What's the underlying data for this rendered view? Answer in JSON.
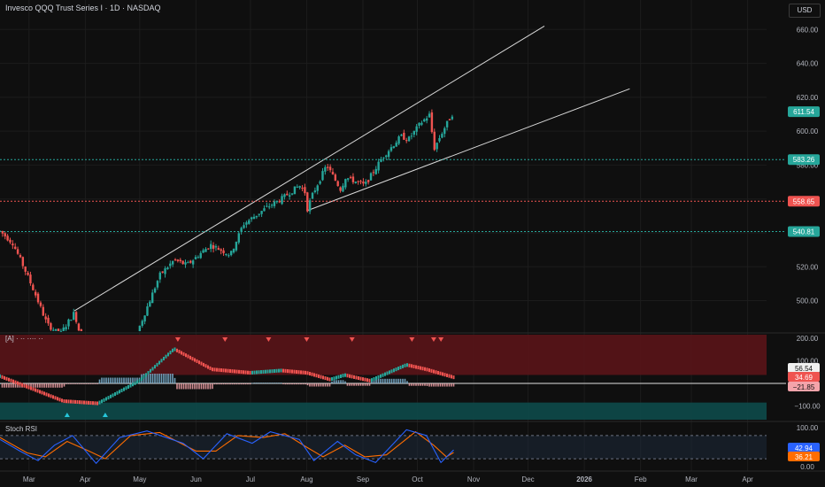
{
  "header": {
    "title": "Invesco QQQ Trust Series I · 1D · NASDAQ",
    "currency": "USD"
  },
  "colors": {
    "up": "#26a69a",
    "down": "#ef5350",
    "grid": "#1c1c1c",
    "text": "#b2b5be",
    "trendline": "#d9d9d9"
  },
  "chart_data": [
    {
      "type": "candlestick",
      "title": "Invesco QQQ Trust Series I · 1D · NASDAQ",
      "x_ticks": [
        "Mar",
        "Apr",
        "May",
        "Jun",
        "Jul",
        "Aug",
        "Sep",
        "Oct",
        "Nov",
        "Dec",
        "2026",
        "Feb",
        "Mar",
        "Apr"
      ],
      "y_ticks": [
        500,
        520,
        540,
        560,
        580,
        600,
        620,
        640,
        660
      ],
      "ylim": [
        482,
        668
      ],
      "last_price": 611.54,
      "price_path": [
        {
          "date": "2025-02-13",
          "close": 541
        },
        {
          "date": "2025-02-20",
          "close": 534
        },
        {
          "date": "2025-02-26",
          "close": 520
        },
        {
          "date": "2025-03-04",
          "close": 505
        },
        {
          "date": "2025-03-11",
          "close": 486
        },
        {
          "date": "2025-03-18",
          "close": 480
        },
        {
          "date": "2025-03-26",
          "close": 493
        },
        {
          "date": "2025-04-04",
          "close": 455
        },
        {
          "date": "2025-04-08",
          "close": 425
        },
        {
          "date": "2025-04-10",
          "close": 455
        },
        {
          "date": "2025-04-21",
          "close": 445
        },
        {
          "date": "2025-05-01",
          "close": 485
        },
        {
          "date": "2025-05-12",
          "close": 515
        },
        {
          "date": "2025-05-20",
          "close": 524
        },
        {
          "date": "2025-05-27",
          "close": 521
        },
        {
          "date": "2025-06-09",
          "close": 533
        },
        {
          "date": "2025-06-20",
          "close": 527
        },
        {
          "date": "2025-06-27",
          "close": 545
        },
        {
          "date": "2025-07-10",
          "close": 555
        },
        {
          "date": "2025-07-18",
          "close": 560
        },
        {
          "date": "2025-07-28",
          "close": 568
        },
        {
          "date": "2025-07-31",
          "close": 564
        },
        {
          "date": "2025-08-01",
          "close": 553
        },
        {
          "date": "2025-08-04",
          "close": 562
        },
        {
          "date": "2025-08-12",
          "close": 580
        },
        {
          "date": "2025-08-20",
          "close": 565
        },
        {
          "date": "2025-08-22",
          "close": 573
        },
        {
          "date": "2025-09-02",
          "close": 568
        },
        {
          "date": "2025-09-12",
          "close": 585
        },
        {
          "date": "2025-09-22",
          "close": 597
        },
        {
          "date": "2025-09-26",
          "close": 595
        },
        {
          "date": "2025-10-03",
          "close": 605
        },
        {
          "date": "2025-10-08",
          "close": 610
        },
        {
          "date": "2025-10-10",
          "close": 589
        },
        {
          "date": "2025-10-14",
          "close": 598
        },
        {
          "date": "2025-10-17",
          "close": 604
        },
        {
          "date": "2025-10-21",
          "close": 611.54
        }
      ],
      "horizontal_levels": [
        {
          "value": 583.26,
          "label": "583.26",
          "color": "#26a69a"
        },
        {
          "value": 558.65,
          "label": "558.65",
          "color": "#ef5350"
        },
        {
          "value": 540.81,
          "label": "540.81",
          "color": "#26a69a"
        }
      ],
      "trendlines": [
        {
          "from": {
            "date": "2025-03-26",
            "price": 494
          },
          "to": {
            "date": "2025-12-10",
            "price": 662
          }
        },
        {
          "from": {
            "date": "2025-08-01",
            "price": 553
          },
          "to": {
            "date": "2026-01-26",
            "price": 625
          }
        }
      ]
    },
    {
      "type": "oscillator",
      "label": "[A] · ·· ···· ··",
      "y_ticks": [
        200,
        100,
        0,
        -100
      ],
      "ylim": [
        -160,
        215
      ],
      "value_labels": [
        {
          "value": 56.54,
          "label": "56.54",
          "color": "#e6e6e6"
        },
        {
          "value": 34.69,
          "label": "34.69",
          "color": "#ef5350"
        },
        {
          "value": -21.85,
          "label": "−21.85",
          "color": "#f4a3aa"
        }
      ],
      "wave": [
        {
          "date": "2025-02-13",
          "value": 40
        },
        {
          "date": "2025-03-01",
          "value": -10
        },
        {
          "date": "2025-03-20",
          "value": -70
        },
        {
          "date": "2025-04-08",
          "value": -80
        },
        {
          "date": "2025-05-01",
          "value": 20
        },
        {
          "date": "2025-05-20",
          "value": 160
        },
        {
          "date": "2025-06-10",
          "value": 70
        },
        {
          "date": "2025-07-01",
          "value": 55
        },
        {
          "date": "2025-07-18",
          "value": 65
        },
        {
          "date": "2025-08-01",
          "value": 55
        },
        {
          "date": "2025-08-14",
          "value": 25
        },
        {
          "date": "2025-08-22",
          "value": 45
        },
        {
          "date": "2025-09-05",
          "value": 20
        },
        {
          "date": "2025-09-25",
          "value": 90
        },
        {
          "date": "2025-10-06",
          "value": 70
        },
        {
          "date": "2025-10-21",
          "value": 35
        }
      ],
      "signals": [
        {
          "date": "2025-03-22",
          "kind": "buy"
        },
        {
          "date": "2025-04-12",
          "kind": "buy"
        },
        {
          "date": "2025-05-22",
          "kind": "sell"
        },
        {
          "date": "2025-06-17",
          "kind": "sell"
        },
        {
          "date": "2025-07-11",
          "kind": "sell"
        },
        {
          "date": "2025-08-01",
          "kind": "sell"
        },
        {
          "date": "2025-08-26",
          "kind": "sell"
        },
        {
          "date": "2025-09-28",
          "kind": "sell"
        },
        {
          "date": "2025-10-10",
          "kind": "sell"
        },
        {
          "date": "2025-10-14",
          "kind": "sell"
        }
      ]
    },
    {
      "type": "oscillator",
      "label": "Stoch RSI",
      "y_ticks": [
        100,
        50,
        0
      ],
      "ylim": [
        -12,
        112
      ],
      "value_labels": [
        {
          "value": 42.94,
          "label": "42.94",
          "color": "#2962ff"
        },
        {
          "value": 36.21,
          "label": "36.21",
          "color": "#ff6d00"
        }
      ],
      "k_line": [
        {
          "date": "2025-02-13",
          "value": 70
        },
        {
          "date": "2025-02-24",
          "value": 40
        },
        {
          "date": "2025-03-06",
          "value": 15
        },
        {
          "date": "2025-03-15",
          "value": 55
        },
        {
          "date": "2025-03-25",
          "value": 80
        },
        {
          "date": "2025-04-07",
          "value": 8
        },
        {
          "date": "2025-04-20",
          "value": 75
        },
        {
          "date": "2025-05-05",
          "value": 92
        },
        {
          "date": "2025-05-25",
          "value": 60
        },
        {
          "date": "2025-06-05",
          "value": 20
        },
        {
          "date": "2025-06-18",
          "value": 85
        },
        {
          "date": "2025-07-02",
          "value": 60
        },
        {
          "date": "2025-07-12",
          "value": 90
        },
        {
          "date": "2025-07-28",
          "value": 70
        },
        {
          "date": "2025-08-05",
          "value": 15
        },
        {
          "date": "2025-08-18",
          "value": 65
        },
        {
          "date": "2025-08-28",
          "value": 30
        },
        {
          "date": "2025-09-08",
          "value": 10
        },
        {
          "date": "2025-09-25",
          "value": 95
        },
        {
          "date": "2025-10-06",
          "value": 80
        },
        {
          "date": "2025-10-14",
          "value": 10
        },
        {
          "date": "2025-10-21",
          "value": 42.94
        }
      ],
      "d_line": [
        {
          "date": "2025-02-13",
          "value": 75
        },
        {
          "date": "2025-02-28",
          "value": 35
        },
        {
          "date": "2025-03-10",
          "value": 25
        },
        {
          "date": "2025-03-22",
          "value": 65
        },
        {
          "date": "2025-04-03",
          "value": 40
        },
        {
          "date": "2025-04-12",
          "value": 20
        },
        {
          "date": "2025-04-26",
          "value": 80
        },
        {
          "date": "2025-05-12",
          "value": 88
        },
        {
          "date": "2025-06-01",
          "value": 40
        },
        {
          "date": "2025-06-12",
          "value": 40
        },
        {
          "date": "2025-06-24",
          "value": 80
        },
        {
          "date": "2025-07-08",
          "value": 75
        },
        {
          "date": "2025-07-20",
          "value": 85
        },
        {
          "date": "2025-08-01",
          "value": 50
        },
        {
          "date": "2025-08-10",
          "value": 25
        },
        {
          "date": "2025-08-22",
          "value": 55
        },
        {
          "date": "2025-09-02",
          "value": 25
        },
        {
          "date": "2025-09-14",
          "value": 30
        },
        {
          "date": "2025-09-30",
          "value": 90
        },
        {
          "date": "2025-10-10",
          "value": 55
        },
        {
          "date": "2025-10-17",
          "value": 25
        },
        {
          "date": "2025-10-21",
          "value": 36.21
        }
      ]
    }
  ]
}
